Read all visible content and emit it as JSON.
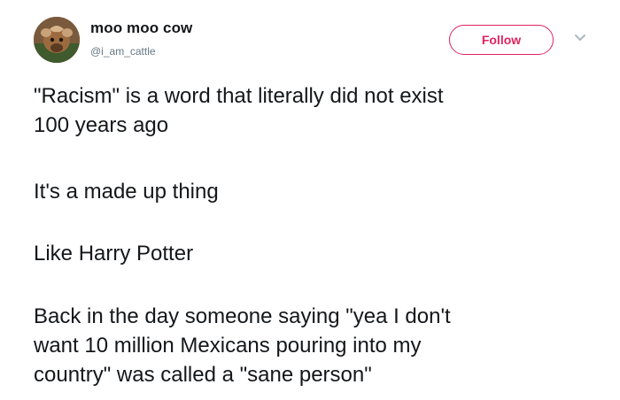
{
  "user": {
    "display_name": "moo moo cow",
    "handle": "@i_am_cattle"
  },
  "actions": {
    "follow_label": "Follow",
    "accent_color": "#e0245e"
  },
  "icons": {
    "avatar": "cow-avatar",
    "more": "chevron-down-icon"
  },
  "tweet": {
    "paragraphs": [
      {
        "lines": [
          "\"Racism\" is a word that literally did not exist",
          "100 years ago"
        ]
      },
      {
        "lines": [
          "It's a made up thing"
        ]
      },
      {
        "lines": [
          "Like Harry Potter"
        ]
      },
      {
        "lines": [
          "Back in the day someone saying \"yea I don't",
          "want 10 million Mexicans pouring into my",
          "country\" was called a \"sane person\""
        ]
      }
    ]
  }
}
